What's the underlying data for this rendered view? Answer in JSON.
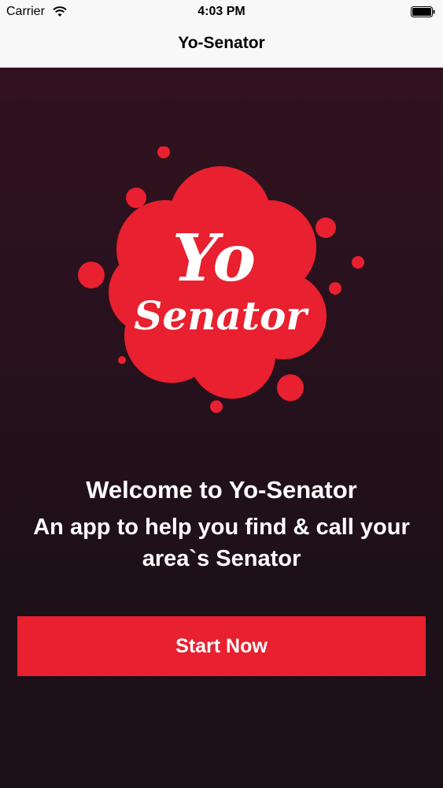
{
  "status_bar": {
    "carrier": "Carrier",
    "time": "4:03 PM",
    "wifi_icon": "wifi-icon",
    "battery_icon": "battery-icon"
  },
  "nav_bar": {
    "title": "Yo-Senator"
  },
  "main": {
    "logo": {
      "line1": "Yo",
      "line2": "Senator",
      "color": "#e8202f"
    },
    "welcome": "Welcome to Yo-Senator",
    "tagline": "An app to help you find & call your area`s Senator",
    "start_button_label": "Start Now"
  },
  "colors": {
    "accent": "#e8202f",
    "background_top": "#32121f",
    "background_bottom": "#1b0f18"
  }
}
